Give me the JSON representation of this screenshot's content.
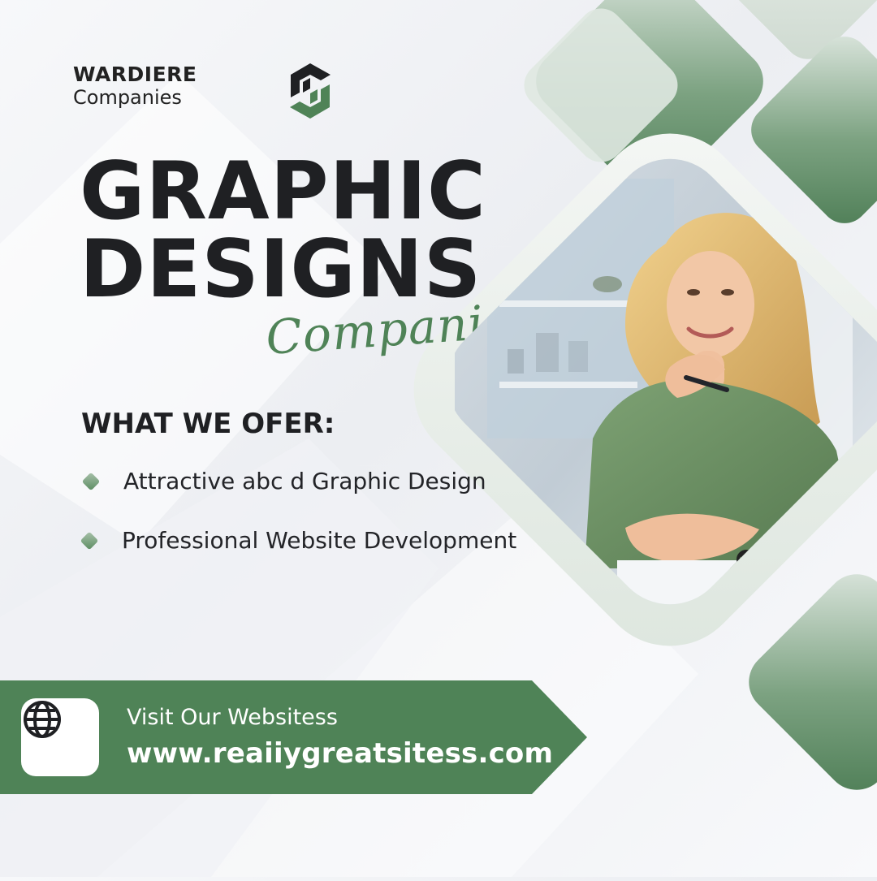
{
  "brand": {
    "name": "WARDIERE",
    "subtitle": "Companies"
  },
  "headline": {
    "line1": "GRAPHIC",
    "line2": "DESIGNS",
    "script": "Companies"
  },
  "offer": {
    "title": "WHAT WE OFER:",
    "items": [
      "Attractive abc d Graphic Design",
      "Professional Website Development"
    ]
  },
  "cta": {
    "label": "Visit Our Websitess",
    "url": "www.reaiiygreatsitess.com",
    "icon": "globe-icon"
  },
  "theme": {
    "accent": "#4f8357",
    "accent_light": "#b9d0bc",
    "text": "#1f2023"
  }
}
